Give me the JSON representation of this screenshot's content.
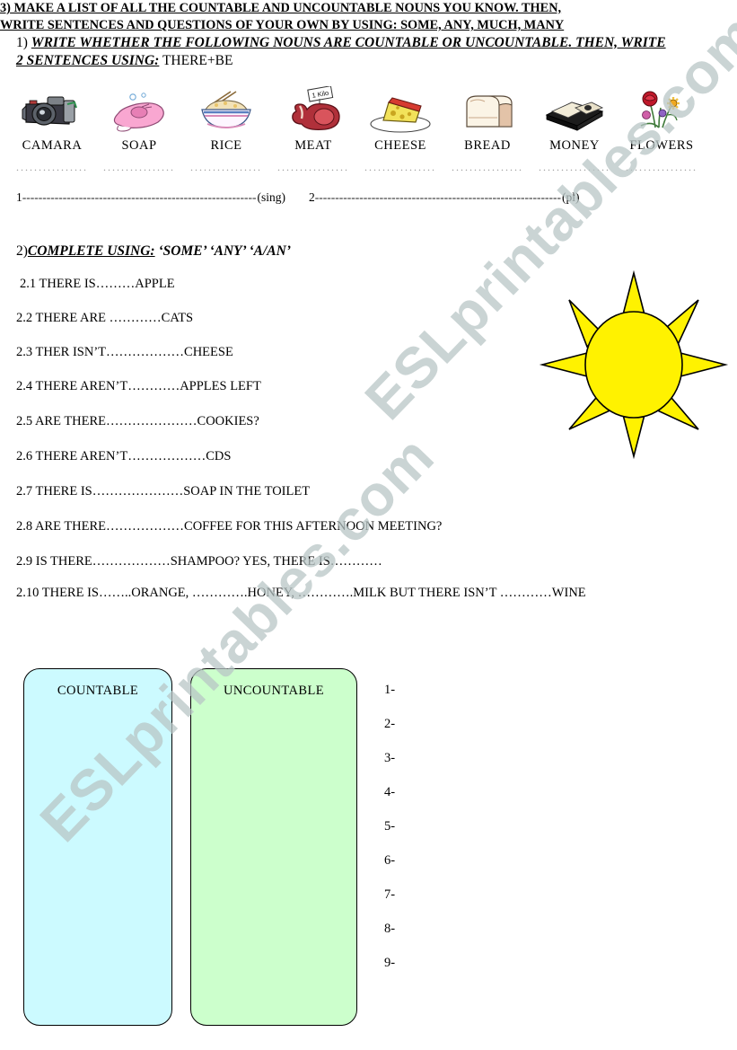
{
  "watermark": {
    "line_a": "ESLprintables.com",
    "line_b": "ESLprintables.com"
  },
  "section1": {
    "number": "1)",
    "heading_line1": "WRITE WHETHER THE FOLLOWING NOUNS ARE COUNTABLE OR UNCOUNTABLE. THEN, WRITE",
    "heading_line2": "2 SENTENCES USING:",
    "heading_suffix": "THERE+BE",
    "pictures": [
      {
        "label": "CAMARA",
        "icon": "camera-icon",
        "dots": "................"
      },
      {
        "label": "SOAP",
        "icon": "soap-icon",
        "dots": "................"
      },
      {
        "label": "RICE",
        "icon": "rice-bowl-icon",
        "dots": "................"
      },
      {
        "label": "MEAT",
        "icon": "meat-icon",
        "dots": "................"
      },
      {
        "label": "CHEESE",
        "icon": "cheese-icon",
        "dots": "................"
      },
      {
        "label": "BREAD",
        "icon": "bread-icon",
        "dots": "................"
      },
      {
        "label": "MONEY",
        "icon": "money-icon",
        "dots": "................"
      },
      {
        "label": "FLOWERS",
        "icon": "flowers-icon",
        "dots": "................"
      }
    ],
    "answer_lines": [
      {
        "number": "1",
        "dashes": "----------------------------------------------------------",
        "tag": "(sing)"
      },
      {
        "number": "2",
        "dashes": "-------------------------------------------------------------",
        "tag": "(pl)"
      }
    ]
  },
  "section2": {
    "number": "2)",
    "heading": "COMPLETE USING:",
    "heading_options": "‘SOME’  ‘ANY’   ‘A/AN’",
    "questions": [
      {
        "number": "2.1",
        "text": "THERE IS………APPLE"
      },
      {
        "number": "2.2",
        "text": "THERE ARE …………CATS"
      },
      {
        "number": "2.3",
        "text": "THER ISN’T………………CHEESE"
      },
      {
        "number": "2.4",
        "text": "THERE AREN’T…………APPLES LEFT"
      },
      {
        "number": "2.5",
        "text": "ARE THERE…………………COOKIES?"
      },
      {
        "number": "2.6",
        "text": "THERE AREN’T………………CDS"
      },
      {
        "number": "2.7",
        "text": "THERE IS…………………SOAP IN THE TOILET"
      },
      {
        "number": "2.8",
        "text": "ARE THERE………………COFFEE FOR THIS AFTERNOON MEETING?"
      },
      {
        "number": "2.9",
        "text": "IS THERE………………SHAMPOO? YES, THERE IS…………"
      },
      {
        "number": "2.10",
        "text": "THERE  IS……..ORANGE, ………….HONEY, ………….MILK BUT THERE ISN’T …………WINE"
      }
    ]
  },
  "sun": {
    "fill_color": "#FFF200",
    "stroke_color": "#000000",
    "ray_count": 8
  },
  "section3": {
    "number": "3)",
    "heading_line1": "MAKE A LIST OF ALL THE COUNTABLE AND UNCOUNTABLE NOUNS YOU KNOW. THEN,",
    "heading_line2": "WRITE SENTENCES AND QUESTIONS OF YOUR OWN BY USING: SOME, ANY, MUCH, MANY",
    "boxes": [
      {
        "title": "COUNTABLE",
        "color": "#CCFAFF"
      },
      {
        "title": "UNCOUNTABLE",
        "color": "#CCFFCC"
      }
    ],
    "numbered_items": [
      "1-",
      "2-",
      "3-",
      "4-",
      "5-",
      "6-",
      "7-",
      "8-",
      "9-"
    ]
  }
}
